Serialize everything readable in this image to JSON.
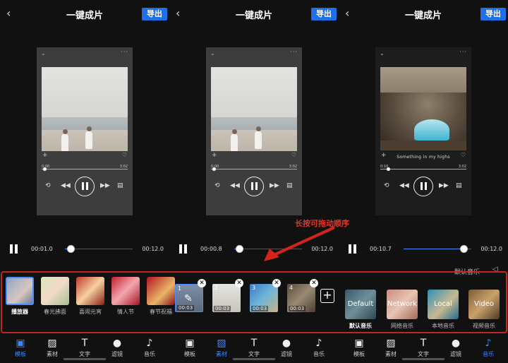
{
  "header": {
    "back": "‹",
    "title": "一键成片",
    "export": "导出"
  },
  "preview": {
    "menu": "···",
    "chevron": "⌄",
    "plus": "+",
    "heart": "♡",
    "lyric": "Something in my highs",
    "panel1": {
      "start": "0:00",
      "end": "3:02",
      "progress_fraction": 0.02
    },
    "panel2": {
      "start": "0:00",
      "end": "3:02",
      "progress_fraction": 0.02
    },
    "panel3": {
      "start": "0:10",
      "end": "3:02",
      "progress_fraction": 0.08
    },
    "icons": [
      "repeat-icon",
      "prev-icon",
      "pause-icon",
      "next-icon",
      "lyrics-icon"
    ]
  },
  "timeline": {
    "panel1": {
      "current": "00:01.0",
      "end": "00:12.0",
      "progress_fraction": 0.08
    },
    "panel2": {
      "current": "00:00.8",
      "end": "00:12.0",
      "progress_fraction": 0.07
    },
    "panel3": {
      "current": "00:10.7",
      "end": "00:12.0",
      "progress_fraction": 0.89
    }
  },
  "annotation": "长按可拖动顺序",
  "music_hint": "默认音乐",
  "templates": [
    {
      "label": "播放器",
      "selected": true
    },
    {
      "label": "春光拂面",
      "selected": false
    },
    {
      "label": "喜闹元宵",
      "selected": false
    },
    {
      "label": "情人节",
      "selected": false
    },
    {
      "label": "春节祝福",
      "selected": false
    }
  ],
  "materials": [
    {
      "num": "1",
      "time": "00:03",
      "selected": true
    },
    {
      "num": "2",
      "time": "00:03",
      "selected": false
    },
    {
      "num": "3",
      "time": "00:03",
      "selected": false
    },
    {
      "num": "4",
      "time": "00:03",
      "selected": false
    }
  ],
  "material_remove": "✕",
  "material_add": "+",
  "music_items": [
    {
      "word": "Default",
      "label": "默认音乐",
      "selected": true
    },
    {
      "word": "Network",
      "label": "网络音乐",
      "selected": false
    },
    {
      "word": "Local",
      "label": "本地音乐",
      "selected": false
    },
    {
      "word": "Video",
      "label": "视频音乐",
      "selected": false
    }
  ],
  "tabs": {
    "panel1": {
      "active": "模板"
    },
    "panel2": {
      "active": "素材"
    },
    "panel3": {
      "active": "音乐"
    },
    "labels": [
      "模板",
      "素材",
      "文字",
      "滤镜",
      "音乐"
    ]
  },
  "colors": {
    "accent": "#3d84ff",
    "export": "#1f6fe6",
    "annotation": "#e0352b"
  }
}
